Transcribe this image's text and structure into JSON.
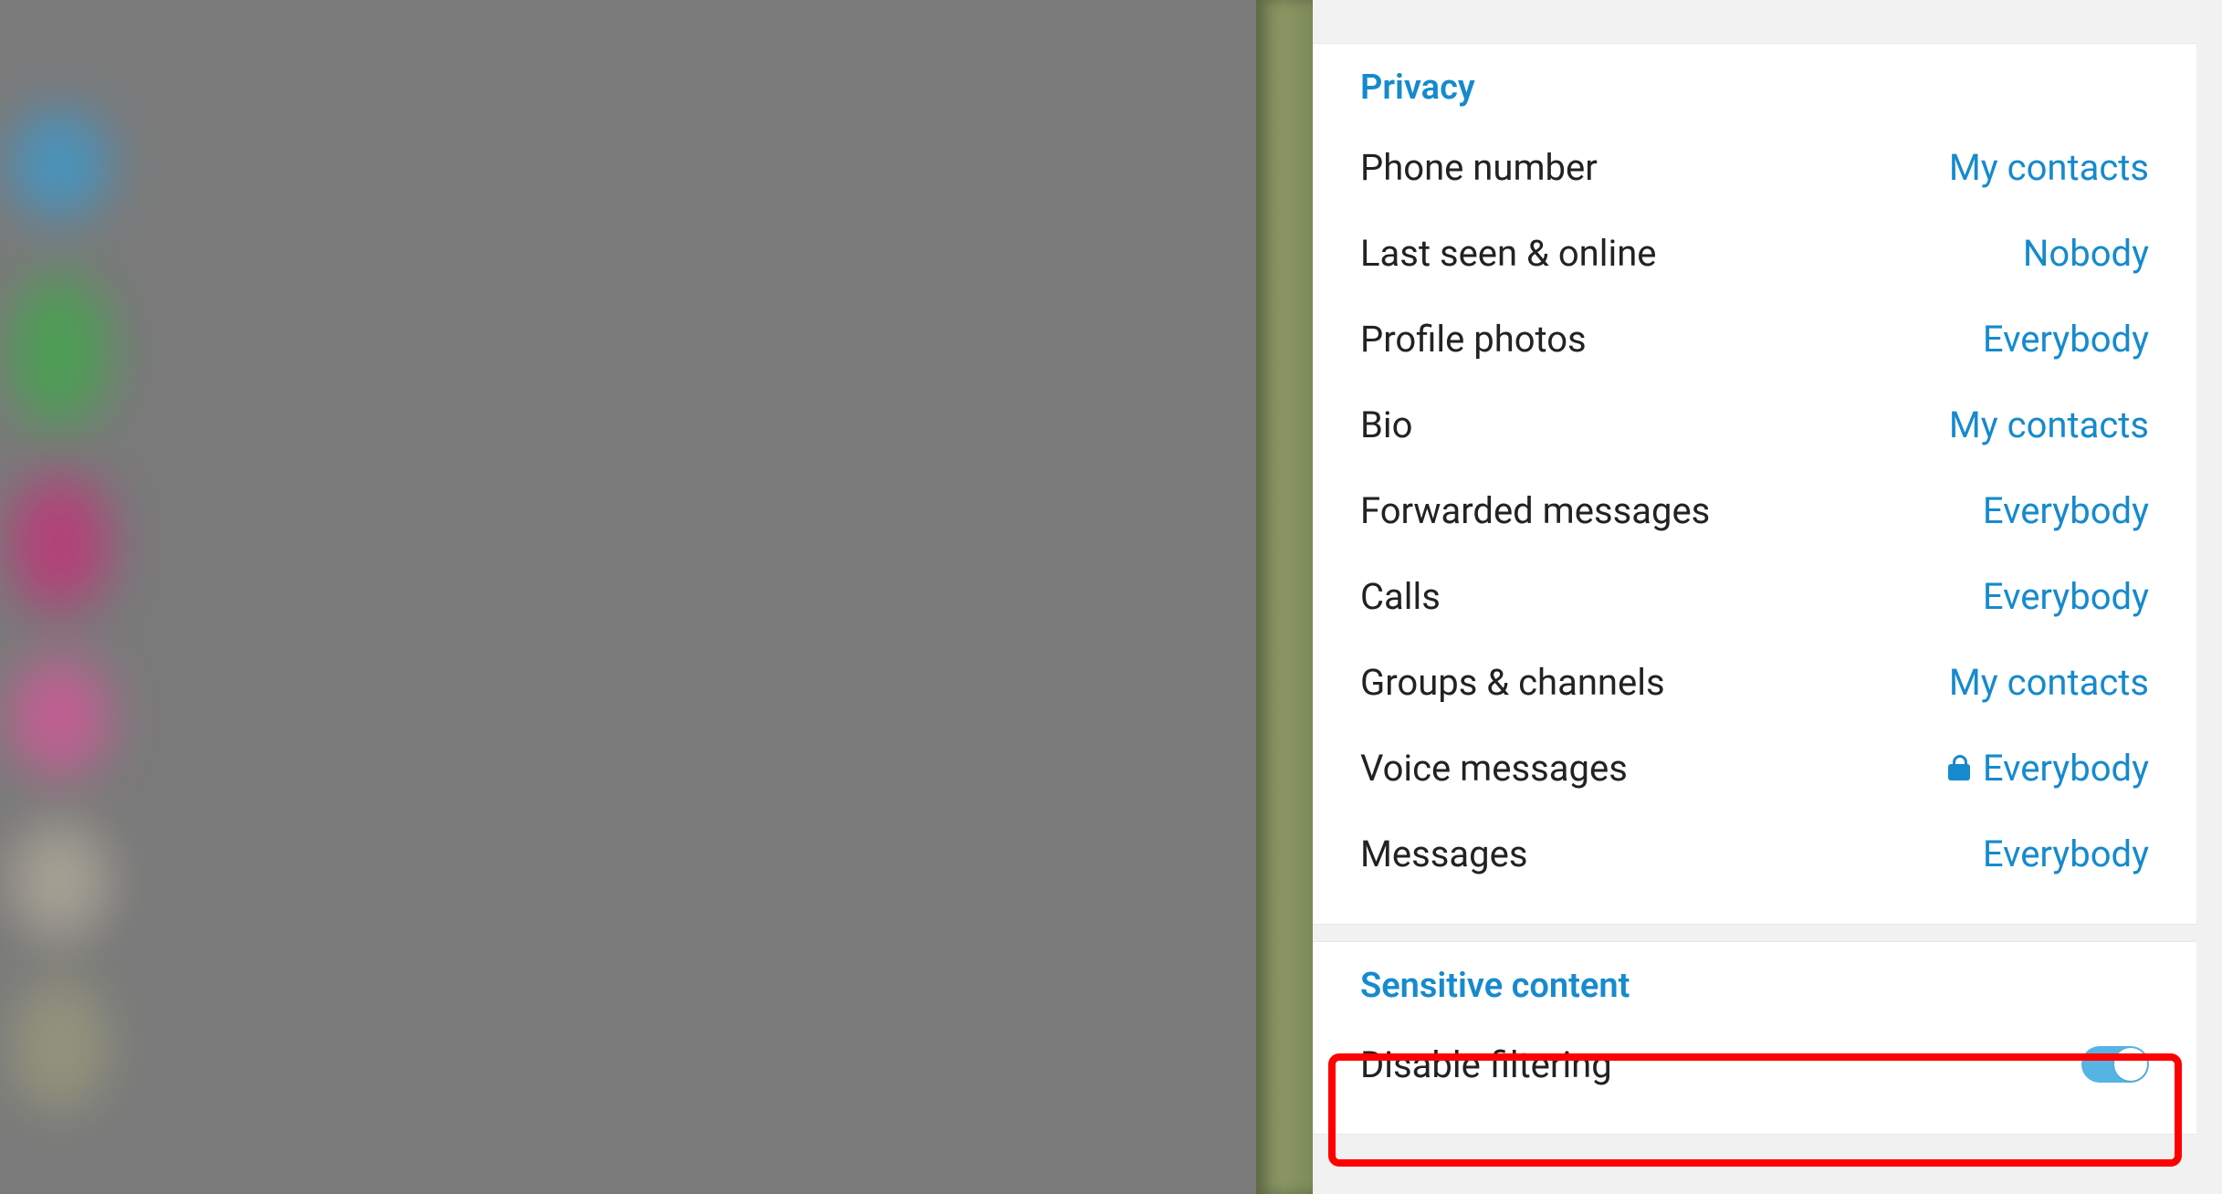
{
  "sections": {
    "privacy": {
      "title": "Privacy",
      "items": [
        {
          "label": "Phone number",
          "value": "My contacts",
          "locked": false
        },
        {
          "label": "Last seen & online",
          "value": "Nobody",
          "locked": false
        },
        {
          "label": "Profile photos",
          "value": "Everybody",
          "locked": false
        },
        {
          "label": "Bio",
          "value": "My contacts",
          "locked": false
        },
        {
          "label": "Forwarded messages",
          "value": "Everybody",
          "locked": false
        },
        {
          "label": "Calls",
          "value": "Everybody",
          "locked": false
        },
        {
          "label": "Groups & channels",
          "value": "My contacts",
          "locked": false
        },
        {
          "label": "Voice messages",
          "value": "Everybody",
          "locked": true
        },
        {
          "label": "Messages",
          "value": "Everybody",
          "locked": false
        }
      ]
    },
    "sensitive": {
      "title": "Sensitive content",
      "disable_filtering_label": "Disable filtering",
      "disable_filtering_on": true
    }
  },
  "colors": {
    "accent": "#168acd",
    "highlight": "#ff0000"
  }
}
